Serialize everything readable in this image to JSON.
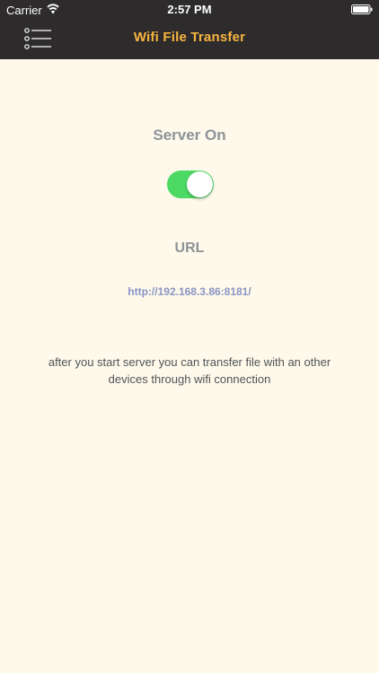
{
  "status_bar": {
    "carrier": "Carrier",
    "time": "2:57 PM",
    "wifi_icon": "wifi-icon",
    "battery_icon": "battery-full-icon"
  },
  "nav": {
    "title": "Wifi File Transfer",
    "menu_icon": "menu-list-icon",
    "title_color": "#f7b540",
    "background": "#2e2b2c"
  },
  "server": {
    "label": "Server On",
    "toggle_on": true,
    "toggle_color": "#4cd964"
  },
  "url": {
    "label": "URL",
    "value": "http://192.168.3.86:8181/"
  },
  "description": "after you start server you can transfer file with an other devices through wifi connection",
  "colors": {
    "background": "#fef9ea",
    "label": "#8d9399",
    "link": "#8a95c6",
    "text": "#505458"
  }
}
